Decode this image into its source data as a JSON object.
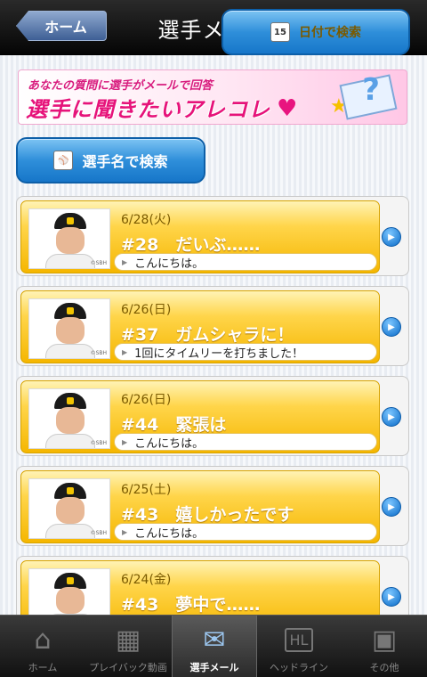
{
  "header": {
    "back_label": "ホーム",
    "title": "選手メール"
  },
  "banner": {
    "subtitle": "あなたの質問に選手がメールで回答",
    "headline": "選手に聞きたいアレコレ"
  },
  "search": {
    "player_label": "選手名で検索",
    "date_label": "日付で検索",
    "date_icon_text": "15"
  },
  "messages": [
    {
      "date": "6/28(火)",
      "subject": "#28　だいぶ……",
      "preview": "こんにちは。"
    },
    {
      "date": "6/26(日)",
      "subject": "#37　ガムシャラに！",
      "preview": "1回にタイムリーを打ちました！"
    },
    {
      "date": "6/26(日)",
      "subject": "#44　緊張は",
      "preview": "こんにちは。"
    },
    {
      "date": "6/25(土)",
      "subject": "#43　嬉しかったです",
      "preview": "こんにちは。"
    },
    {
      "date": "6/24(金)",
      "subject": "#43　夢中で……",
      "preview": ""
    }
  ],
  "photo_credit": "©SBH",
  "tabs": [
    {
      "label": "ホーム",
      "icon": "home-icon",
      "active": false
    },
    {
      "label": "プレイバック動画",
      "icon": "film-icon",
      "active": false
    },
    {
      "label": "選手メール",
      "icon": "mail-icon",
      "active": true
    },
    {
      "label": "ヘッドライン",
      "icon": "headline-icon",
      "active": false
    },
    {
      "label": "その他",
      "icon": "other-icon",
      "active": false
    }
  ],
  "colors": {
    "header": "#0a0a0a",
    "card_gold": "#f5b600",
    "button_blue": "#2f8fda",
    "banner_pink": "#e6137a"
  }
}
